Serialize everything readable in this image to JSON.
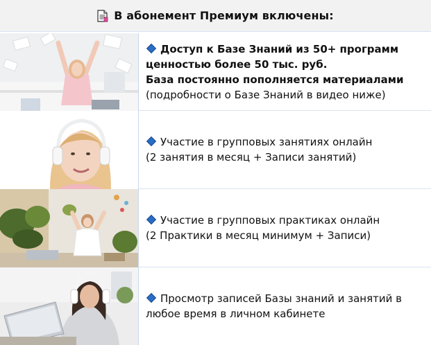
{
  "header": {
    "title": "В абонемент Премиум включены:",
    "icon": "document-icon"
  },
  "features": [
    {
      "icon": "blue-diamond-icon",
      "lines": [
        {
          "text": "Доступ к Базе Знаний из 50+ программ",
          "bold": true
        },
        {
          "text": "ценностью более 50 тыс. руб.",
          "bold": true
        },
        {
          "text": "База постоянно пополняется материалами",
          "bold": true
        },
        {
          "text": "(подробности о Базе Знаний в видео ниже)",
          "bold": false
        }
      ]
    },
    {
      "icon": "blue-diamond-icon",
      "lines": [
        {
          "text": "Участие в групповых занятиях онлайн",
          "bold": false
        },
        {
          "text": "(2 занятия в месяц + Записи занятий)",
          "bold": false
        }
      ]
    },
    {
      "icon": "blue-diamond-icon",
      "lines": [
        {
          "text": "Участие в групповых практиках онлайн",
          "bold": false
        },
        {
          "text": "(2 Практики в месяц минимум + Записи)",
          "bold": false
        }
      ]
    },
    {
      "icon": "blue-diamond-icon",
      "lines": [
        {
          "text": "Просмотр записей Базы знаний и занятий в",
          "bold": false
        },
        {
          "text": "любое время в личном кабинете",
          "bold": false
        }
      ]
    }
  ],
  "colors": {
    "header_bg": "#f2f2f2",
    "divider": "#c9d8ea",
    "diamond": "#2b6cc4"
  }
}
